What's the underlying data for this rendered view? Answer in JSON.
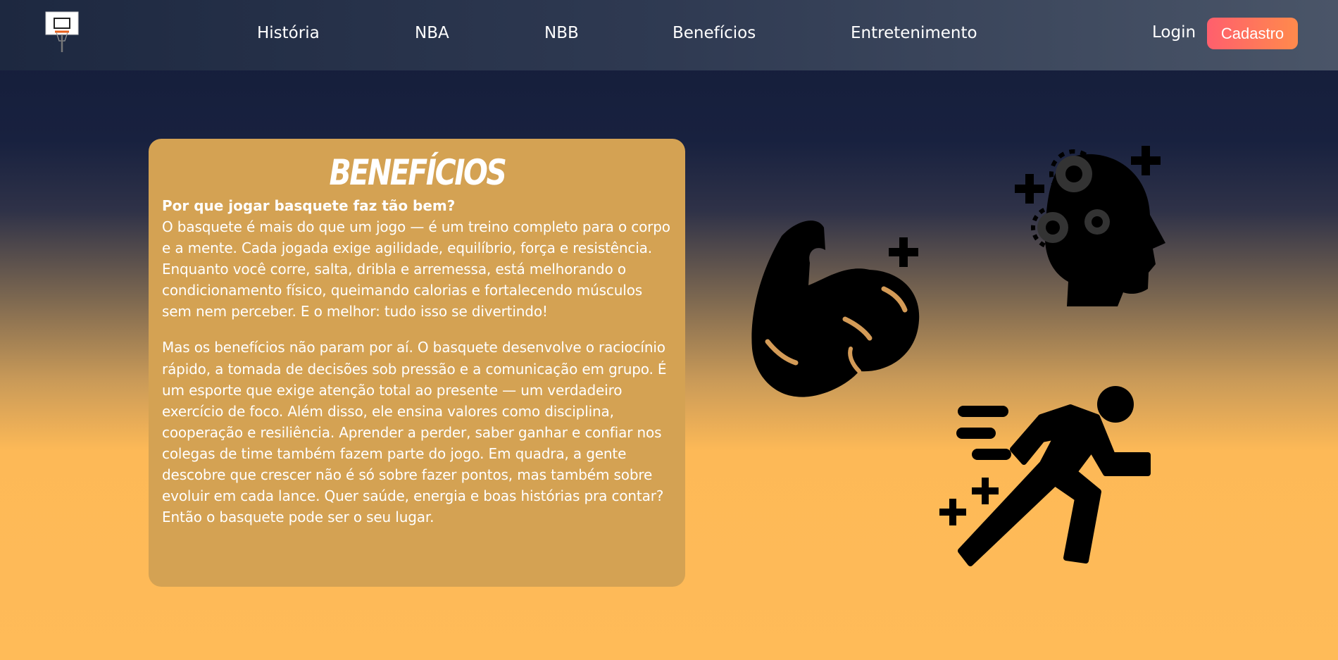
{
  "nav": {
    "logo_icon": "basketball-hoop-icon",
    "links": [
      "História",
      "NBA",
      "NBB",
      "Benefícios",
      "Entretenimento"
    ],
    "login_label": "Login",
    "signup_label": "Cadastro"
  },
  "content": {
    "title": "BENEFÍCIOS",
    "subtitle": "Por que jogar basquete faz tão bem?",
    "paragraph1": "O basquete é mais do que um jogo — é um treino completo para o corpo e a mente. Cada jogada exige agilidade, equilíbrio, força e resistência. Enquanto você corre, salta, dribla e arremessa, está melhorando o condicionamento físico, queimando calorias e fortalecendo músculos sem nem perceber. E o melhor: tudo isso se divertindo!",
    "paragraph2": "Mas os benefícios não param por aí. O basquete desenvolve o raciocínio rápido, a tomada de decisões sob pressão e a comunicação em grupo. É um esporte que exige atenção total ao presente — um verdadeiro exercício de foco. Além disso, ele ensina valores como disciplina, cooperação e resiliência. Aprender a perder, saber ganhar e confiar nos colegas de time também fazem parte do jogo. Em quadra, a gente descobre que crescer não é só sobre fazer pontos, mas também sobre evoluir em cada lance. Quer saúde, energia e boas histórias pra contar? Então o basquete pode ser o seu lugar."
  },
  "illustrations": [
    "flexed-bicep-icon",
    "brain-gears-icon",
    "running-person-icon"
  ],
  "colors": {
    "card": "#d4a253",
    "signup_button": "#ff6b5f",
    "page_bottom": "#ffbb58"
  }
}
